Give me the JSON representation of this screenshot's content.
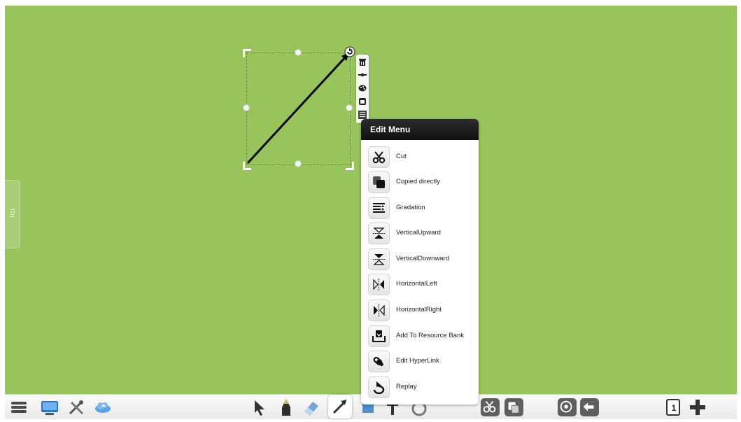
{
  "edit_menu": {
    "title": "Edit Menu",
    "items": [
      {
        "label": "Cut",
        "icon": "scissors-icon"
      },
      {
        "label": "Copied directly",
        "icon": "copy-icon"
      },
      {
        "label": "Gradation",
        "icon": "gradation-icon"
      },
      {
        "label": "VerticalUpward",
        "icon": "vertical-upward-icon"
      },
      {
        "label": "VerticalDownward",
        "icon": "vertical-downward-icon"
      },
      {
        "label": "HorizontalLeft",
        "icon": "horizontal-left-icon"
      },
      {
        "label": "HorizontalRight",
        "icon": "horizontal-right-icon"
      },
      {
        "label": "Add To Resource Bank",
        "icon": "resource-bank-icon"
      },
      {
        "label": "Edit HyperLink",
        "icon": "hyperlink-icon"
      },
      {
        "label": "Replay",
        "icon": "replay-icon"
      }
    ]
  },
  "mini_toolbar": [
    "delete-icon",
    "line-style-icon",
    "color-palette-icon",
    "layer-icon",
    "menu-icon"
  ],
  "side_tab": {
    "icon": "side-panel-icon"
  },
  "bottom_bar": {
    "left": [
      "menu-icon",
      "display-icon",
      "tools-icon",
      "cloud-icon"
    ],
    "center": [
      "select-arrow-icon",
      "pen-icon",
      "eraser-icon",
      "line-tool-icon",
      "shape-tool-icon",
      "text-tool-icon",
      "undo-shape-icon"
    ],
    "right": [
      "scissors-icon",
      "copy-icon",
      "target-icon",
      "back-icon",
      "page-icon",
      "add-page-icon"
    ],
    "page_number": "1"
  },
  "colors": {
    "canvas": "#97c55b",
    "menu_header": "#1a1a1a"
  }
}
